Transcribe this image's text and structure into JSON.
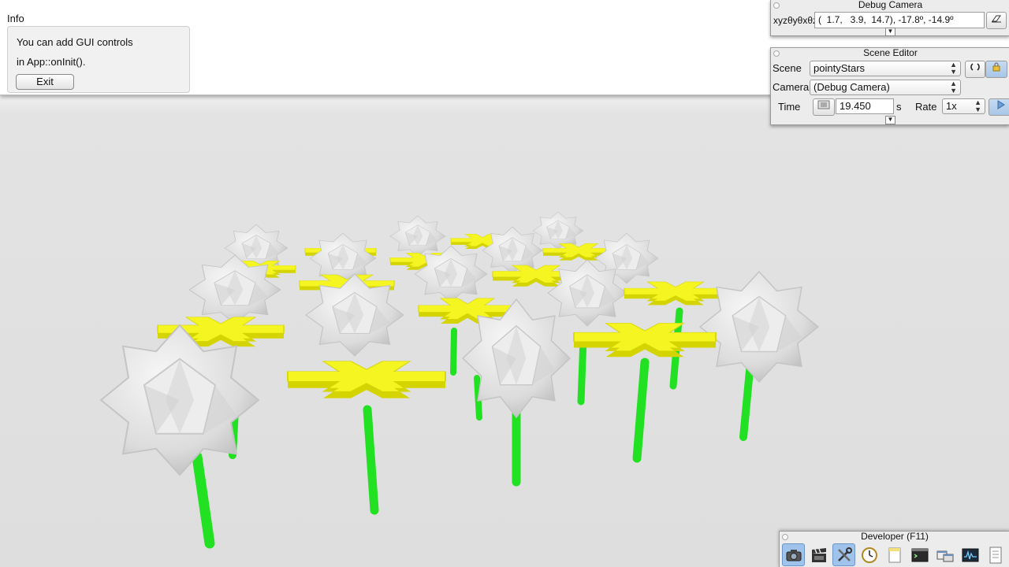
{
  "info": {
    "title": "Info",
    "line1": "You can add GUI controls",
    "line2": "in App::onInit().",
    "exit_label": "Exit"
  },
  "debug_camera": {
    "title": "Debug Camera",
    "label": "xyzθyθxθz",
    "value": "(  1.7,   3.9,  14.7), -17.8º, -14.9º"
  },
  "scene_editor": {
    "title": "Scene Editor",
    "scene_label": "Scene",
    "scene_value": "pointyStars",
    "camera_label": "Camera",
    "camera_value": "(Debug Camera)",
    "time_label": "Time",
    "time_value": "19.450",
    "time_unit": "s",
    "rate_label": "Rate",
    "rate_value": "1x"
  },
  "developer": {
    "title": "Developer (F11)",
    "tools": [
      "camera-icon",
      "film-clapper-icon",
      "tools-icon",
      "clock-icon",
      "notes-icon",
      "terminal-icon",
      "windows-icon",
      "waveform-icon",
      "document-icon"
    ]
  },
  "colors": {
    "petal": "#f5f522",
    "stem": "#22e022",
    "star": "#e8e8e8",
    "floor": "#e6e6e6",
    "active_tool": "#9fc3ea"
  }
}
